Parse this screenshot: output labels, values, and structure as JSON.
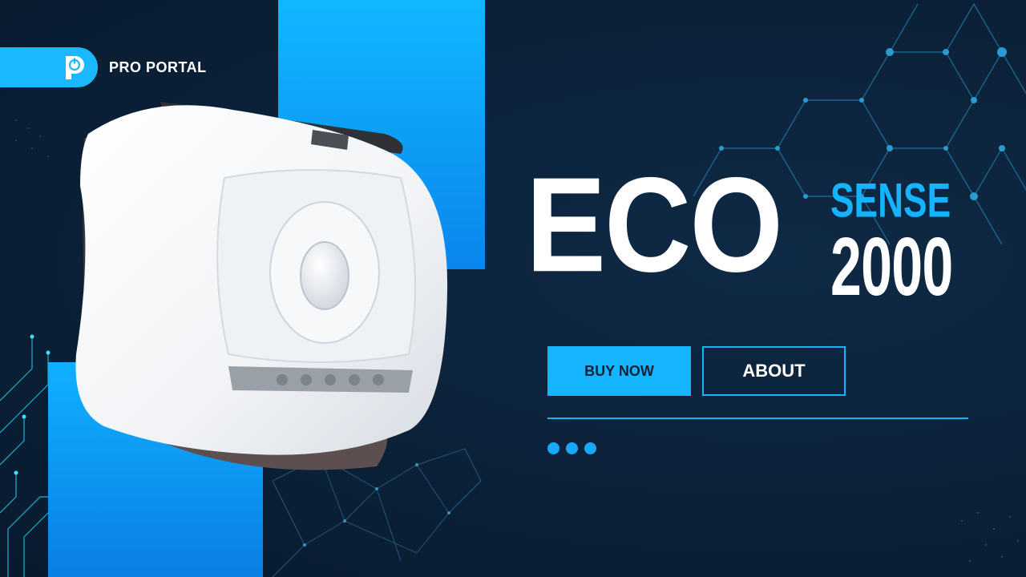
{
  "brand": {
    "logo_icon": "power-p-logo-icon",
    "name": "PRO PORTAL"
  },
  "hero": {
    "title_main": "ECO",
    "title_sub": "SENSE",
    "title_model": "2000",
    "product_image": "air-purifier-device-image"
  },
  "actions": {
    "buy_label": "BUY NOW",
    "about_label": "ABOUT"
  },
  "carousel": {
    "dots_count": 3
  },
  "colors": {
    "background": "#0b2138",
    "accent": "#15b6ff",
    "text": "#ffffff"
  }
}
